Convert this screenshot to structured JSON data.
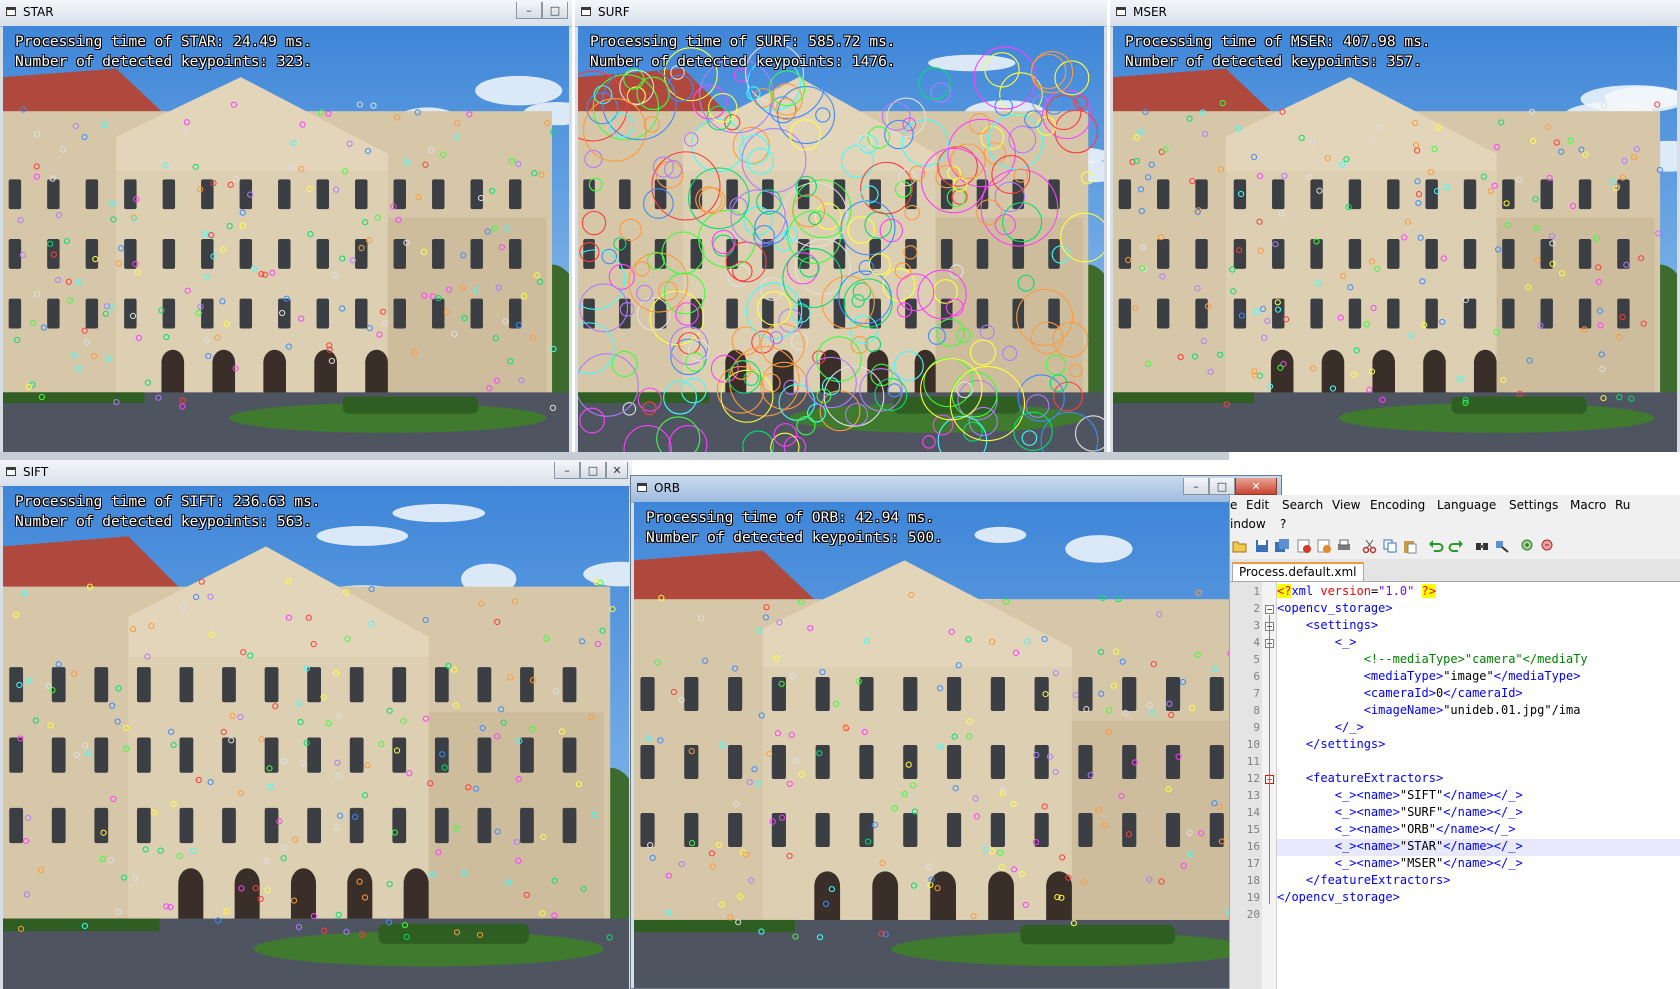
{
  "windows": {
    "star": {
      "title": "STAR",
      "line1": "Processing time of STAR: 24.49 ms.",
      "line2": "Number of detected keypoints: 323.",
      "keypoint_style": "small"
    },
    "surf": {
      "title": "SURF",
      "line1": "Processing time of SURF: 585.72 ms.",
      "line2": "Number of detected keypoints: 1476.",
      "keypoint_style": "large"
    },
    "mser": {
      "title": "MSER",
      "line1": "Processing time of MSER: 407.98 ms.",
      "line2": "Number of detected keypoints: 357.",
      "keypoint_style": "small"
    },
    "sift": {
      "title": "SIFT",
      "line1": "Processing time of SIFT: 236.63 ms.",
      "line2": "Number of detected keypoints: 563.",
      "keypoint_style": "small"
    },
    "orb": {
      "title": "ORB",
      "line1": "Processing time of ORB: 42.94 ms.",
      "line2": "Number of detected keypoints: 500.",
      "keypoint_style": "small"
    }
  },
  "editor": {
    "menu": [
      "e",
      "Edit",
      "Search",
      "View",
      "Encoding",
      "Language",
      "Settings",
      "Macro",
      "Ru"
    ],
    "menu_row2": [
      "indow",
      "?"
    ],
    "tab": "Process.default.xml",
    "line_numbers": [
      "1",
      "2",
      "3",
      "4",
      "5",
      "6",
      "7",
      "8",
      "9",
      "10",
      "11",
      "12",
      "13",
      "14",
      "15",
      "16",
      "17",
      "18",
      "19",
      "20"
    ],
    "lines": [
      "<?xml version=\"1.0\" ?>",
      "<opencv_storage>",
      "    <settings>",
      "        <_>",
      "            <!--mediaType>\"camera\"</mediaTy",
      "            <mediaType>\"image\"</mediaType>",
      "            <cameraId>0</cameraId>",
      "            <imageName>\"unideb.01.jpg\"</ima",
      "        </_>",
      "    </settings>",
      "",
      "    <featureExtractors>",
      "        <_><name>\"SIFT\"</name></_>",
      "        <_><name>\"SURF\"</name></_>",
      "        <_><name>\"ORB\"</name></_>",
      "        <_><name>\"STAR\"</name></_>",
      "        <_><name>\"MSER\"</name></_>",
      "    </featureExtractors>",
      "</opencv_storage>",
      ""
    ],
    "highlighted_line": 16
  },
  "icons": {
    "window_minimize": "minimize-icon",
    "window_maximize": "maximize-icon",
    "window_close": "close-icon"
  },
  "colors": {
    "sky": "#6ea8e6",
    "building": "#d6c7a8",
    "roof": "#b0493d",
    "grass": "#3f7a2f",
    "road": "#4f5560"
  }
}
